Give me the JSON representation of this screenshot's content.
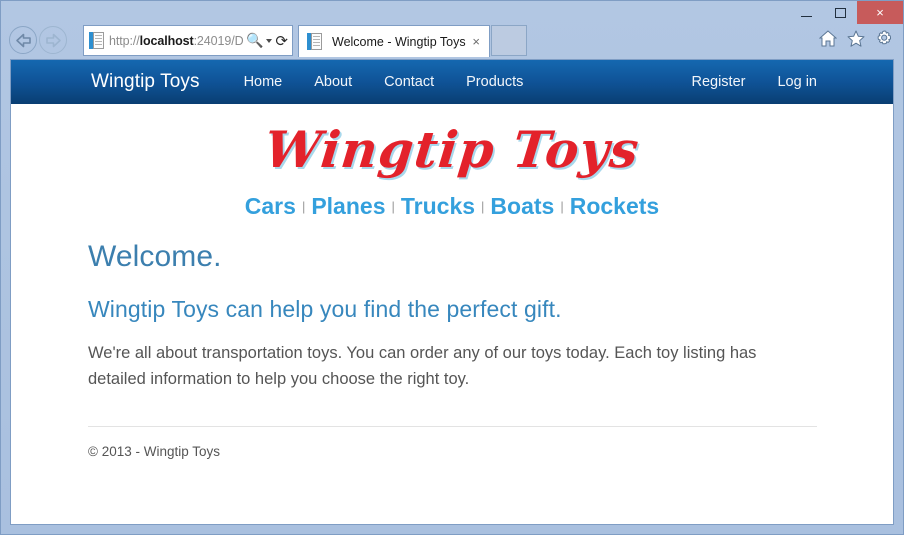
{
  "window": {
    "controls": {
      "minimize": "minimize",
      "maximize": "maximize",
      "close": "×"
    }
  },
  "browser": {
    "back_label": "Back",
    "forward_label": "Forward",
    "address": {
      "url_prefix": "http://",
      "url_host": "localhost",
      "url_rest": ":24019/D",
      "full_url": "http://localhost:24019/D",
      "search_icon": "🔍",
      "refresh_icon": "⟳"
    },
    "tab": {
      "title": "Welcome - Wingtip Toys",
      "close": "×"
    },
    "toolbar_icons": [
      "home-icon",
      "favorites-star-icon",
      "settings-gear-icon"
    ]
  },
  "site": {
    "brand": "Wingtip Toys",
    "nav": [
      {
        "label": "Home"
      },
      {
        "label": "About"
      },
      {
        "label": "Contact"
      },
      {
        "label": "Products"
      }
    ],
    "nav_right": [
      {
        "label": "Register"
      },
      {
        "label": "Log in"
      }
    ],
    "logo_text": "Wingtip Toys",
    "logo_color": "#e3222b",
    "logo_shadow_color": "#a8d8ec",
    "categories": [
      {
        "label": "Cars"
      },
      {
        "label": "Planes"
      },
      {
        "label": "Trucks"
      },
      {
        "label": "Boats"
      },
      {
        "label": "Rockets"
      }
    ],
    "category_separator": "|",
    "category_color": "#34a0dd",
    "heading": "Welcome.",
    "subheading": "Wingtip Toys can help you find the perfect gift.",
    "body_text": "We're all about transportation toys. You can order any of our toys today. Each toy listing has detailed information to help you choose the right toy.",
    "footer": "© 2013 - Wingtip Toys",
    "nav_gradient_top": "#1568b0",
    "nav_gradient_bottom": "#093e72"
  }
}
